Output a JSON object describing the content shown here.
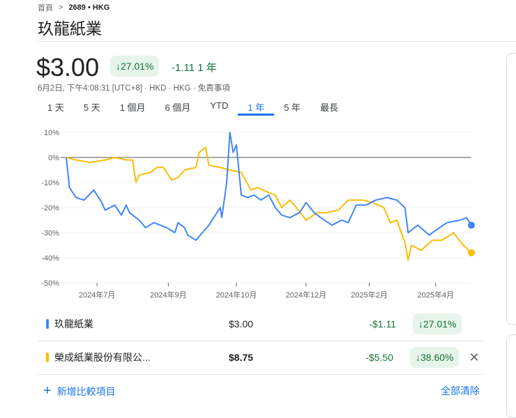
{
  "breadcrumb": {
    "home": "首頁",
    "sep": ">",
    "ticker": "2689 • HKG"
  },
  "title": "玖龍紙業",
  "price": "$3.00",
  "change_pct": "↓27.01%",
  "change_abs": "-1.11 1 年",
  "meta": "6月2日, 下午4:08:31 [UTC+8] · HKD · HKG · 免責事項",
  "tabs": [
    "1 天",
    "5 天",
    "1 個月",
    "6 個月",
    "YTD",
    "1 年",
    "5 年",
    "最長"
  ],
  "active_tab": 5,
  "colors": {
    "blue": "#4285f4",
    "yellow": "#fbbc04",
    "green": "#137333",
    "accent": "#1a73e8"
  },
  "chart_data": {
    "type": "line",
    "xlabel": "",
    "ylabel": "",
    "ylim": [
      -50,
      10
    ],
    "yticks": [
      10,
      0,
      -10,
      -20,
      -30,
      -40,
      -50
    ],
    "ytick_labels": [
      "10%",
      "0%",
      "-10%",
      "-20%",
      "-30%",
      "-40%",
      "-50%"
    ],
    "xlim": [
      0,
      250
    ],
    "xticks": [
      19,
      63,
      105,
      148,
      187,
      228
    ],
    "xtick_labels": [
      "2024年7月",
      "2024年9月",
      "2024年10月",
      "2024年12月",
      "2025年2月",
      "2025年4月"
    ],
    "series": [
      {
        "name": "玖龍紙業",
        "color": "#4285f4",
        "x": [
          0,
          2,
          6,
          11,
          17,
          22,
          24,
          30,
          34,
          37,
          39,
          45,
          49,
          54,
          58,
          62,
          67,
          69,
          73,
          75,
          80,
          84,
          88,
          95,
          96,
          99,
          101,
          103,
          105,
          108,
          112,
          116,
          120,
          125,
          129,
          133,
          138,
          144,
          148,
          153,
          157,
          164,
          170,
          174,
          179,
          185,
          191,
          198,
          204,
          209,
          211,
          217,
          224,
          228,
          235,
          243,
          247,
          250
        ],
        "y": [
          0,
          -12,
          -16,
          -17,
          -13,
          -18,
          -21,
          -19,
          -23,
          -19,
          -22,
          -25,
          -28,
          -26,
          -27,
          -28,
          -30,
          -26,
          -28,
          -31,
          -33,
          -30,
          -27,
          -20,
          -24,
          -10,
          10,
          2,
          5,
          -15,
          -16,
          -15,
          -17,
          -15,
          -20,
          -23,
          -24,
          -22,
          -18,
          -22,
          -24,
          -27,
          -25,
          -26,
          -19,
          -19,
          -17,
          -16,
          -17,
          -20,
          -30,
          -27,
          -31,
          -29,
          -26,
          -25,
          -24,
          -27
        ]
      },
      {
        "name": "榮成紙業股份有限公...",
        "color": "#fbbc04",
        "x": [
          0,
          6,
          15,
          24,
          30,
          37,
          41,
          43,
          45,
          52,
          56,
          60,
          65,
          69,
          73,
          80,
          82,
          86,
          88,
          95,
          101,
          108,
          114,
          118,
          125,
          129,
          133,
          138,
          142,
          148,
          155,
          161,
          168,
          174,
          183,
          189,
          196,
          200,
          204,
          209,
          211,
          213,
          219,
          226,
          232,
          239,
          245,
          250
        ],
        "y": [
          0,
          -1,
          -2,
          -1,
          0,
          -1,
          -1,
          -10,
          -7,
          -6,
          -4,
          -4,
          -9,
          -8,
          -5,
          -4,
          2,
          4,
          -3,
          -4,
          -5,
          -6,
          -13,
          -12,
          -14,
          -15,
          -20,
          -17,
          -20,
          -25,
          -22,
          -22,
          -21,
          -17,
          -17,
          -18,
          -20,
          -26,
          -25,
          -34,
          -41,
          -35,
          -37,
          -33,
          -33,
          -30,
          -35,
          -38
        ]
      }
    ]
  },
  "compare": [
    {
      "name": "玖龍紙業",
      "price": "$3.00",
      "change": "-$1.11",
      "pct": "↓27.01%"
    },
    {
      "name": "榮成紙業股份有限公...",
      "price": "$8.75",
      "change": "-$5.50",
      "pct": "↓38.60%",
      "remove": "✕"
    }
  ],
  "add_label": "新增比較項目",
  "add_icon": "+",
  "clear_label": "全部清除"
}
